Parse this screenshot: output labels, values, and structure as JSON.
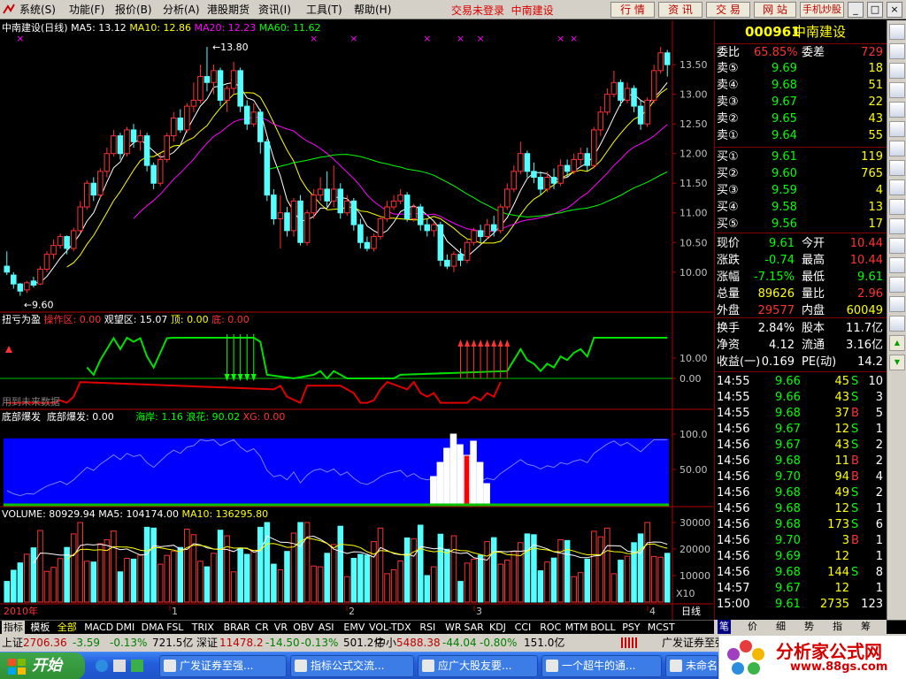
{
  "menubar": {
    "items": [
      "系统(S)",
      "功能(F)",
      "报价(B)",
      "分析(A)",
      "港股期货",
      "资讯(I)",
      "工具(T)",
      "帮助(H)"
    ],
    "login_warning": "交易未登录",
    "stock_name": "中南建设",
    "buttons": [
      "行 情",
      "资 讯",
      "交 易",
      "网 站",
      "手机炒股"
    ],
    "window_buttons": [
      "_",
      "□",
      "×"
    ]
  },
  "main_chart": {
    "title": "中南建设(日线)",
    "ma5": "MA5: 13.12",
    "ma10": "MA10: 12.86",
    "ma20": "MA20: 12.23",
    "ma60": "MA60: 11.62",
    "high_label": "13.80",
    "low_label": "9.60",
    "y_ticks": [
      "13.50",
      "13.00",
      "12.50",
      "12.00",
      "11.50",
      "11.00",
      "10.50",
      "10.00"
    ],
    "candles": [
      [
        10.1,
        10.0,
        10.35,
        9.95
      ],
      [
        9.95,
        9.8,
        10.0,
        9.72
      ],
      [
        9.8,
        9.68,
        9.82,
        9.6
      ],
      [
        9.7,
        9.82,
        9.85,
        9.65
      ],
      [
        9.85,
        9.78,
        9.92,
        9.74
      ],
      [
        9.8,
        10.05,
        10.1,
        9.78
      ],
      [
        10.05,
        10.3,
        10.35,
        10.0
      ],
      [
        10.3,
        10.45,
        10.55,
        10.22
      ],
      [
        10.45,
        10.6,
        10.65,
        10.4
      ],
      [
        10.6,
        10.4,
        10.62,
        10.3
      ],
      [
        10.4,
        10.7,
        10.75,
        10.35
      ],
      [
        10.7,
        11.1,
        11.2,
        10.65
      ],
      [
        11.1,
        11.5,
        11.55,
        11.05
      ],
      [
        11.5,
        11.3,
        11.6,
        11.2
      ],
      [
        11.3,
        11.7,
        11.75,
        11.25
      ],
      [
        11.7,
        12.0,
        12.1,
        11.6
      ],
      [
        12.0,
        12.3,
        12.4,
        11.95
      ],
      [
        12.3,
        12.0,
        12.35,
        11.9
      ],
      [
        12.0,
        12.4,
        12.45,
        11.95
      ],
      [
        12.4,
        12.2,
        12.5,
        12.1
      ],
      [
        12.2,
        12.3,
        12.4,
        12.05
      ],
      [
        12.3,
        11.8,
        12.35,
        11.7
      ],
      [
        11.8,
        11.5,
        11.85,
        11.4
      ],
      [
        11.5,
        11.9,
        12.0,
        11.45
      ],
      [
        11.9,
        12.3,
        12.35,
        11.85
      ],
      [
        12.3,
        12.6,
        12.7,
        12.2
      ],
      [
        12.6,
        12.4,
        12.75,
        12.35
      ],
      [
        12.4,
        12.8,
        12.85,
        12.35
      ],
      [
        12.8,
        12.9,
        13.2,
        12.7
      ],
      [
        12.9,
        13.3,
        13.5,
        12.85
      ],
      [
        13.3,
        13.2,
        13.8,
        13.05
      ],
      [
        13.2,
        13.4,
        13.5,
        13.0
      ],
      [
        13.4,
        12.9,
        13.45,
        12.8
      ],
      [
        12.9,
        13.1,
        13.15,
        12.7
      ],
      [
        13.1,
        13.4,
        13.55,
        13.0
      ],
      [
        13.4,
        12.8,
        13.45,
        12.7
      ],
      [
        12.8,
        12.5,
        12.9,
        12.4
      ],
      [
        12.5,
        12.7,
        12.85,
        12.45
      ],
      [
        12.7,
        12.2,
        12.75,
        12.0
      ],
      [
        12.2,
        11.3,
        12.25,
        11.2
      ],
      [
        11.3,
        10.9,
        11.4,
        10.8
      ],
      [
        10.9,
        11.0,
        11.3,
        10.4
      ],
      [
        11.0,
        10.7,
        11.1,
        10.6
      ],
      [
        10.7,
        11.2,
        11.25,
        10.6
      ],
      [
        11.2,
        10.5,
        11.3,
        10.45
      ],
      [
        10.5,
        11.0,
        11.05,
        10.45
      ],
      [
        11.0,
        11.3,
        11.4,
        10.9
      ],
      [
        11.3,
        11.4,
        11.6,
        11.2
      ],
      [
        11.4,
        11.2,
        11.7,
        11.1
      ],
      [
        11.2,
        11.4,
        11.8,
        11.1
      ],
      [
        11.4,
        11.0,
        11.5,
        10.9
      ],
      [
        11.0,
        11.2,
        11.3,
        10.95
      ],
      [
        11.2,
        10.8,
        11.25,
        10.7
      ],
      [
        10.8,
        10.5,
        10.9,
        10.4
      ],
      [
        10.5,
        10.4,
        10.6,
        10.35
      ],
      [
        10.4,
        10.6,
        10.65,
        10.35
      ],
      [
        10.6,
        10.9,
        10.95,
        10.55
      ],
      [
        10.9,
        11.1,
        11.2,
        10.85
      ],
      [
        11.1,
        11.2,
        11.3,
        11.05
      ],
      [
        11.2,
        11.3,
        11.4,
        11.15
      ],
      [
        11.3,
        10.9,
        11.35,
        10.85
      ],
      [
        10.9,
        11.1,
        11.15,
        10.85
      ],
      [
        11.1,
        10.8,
        11.15,
        10.7
      ],
      [
        10.8,
        10.7,
        10.9,
        10.6
      ],
      [
        10.7,
        10.8,
        10.85,
        10.6
      ],
      [
        10.8,
        10.2,
        10.85,
        10.1
      ],
      [
        10.2,
        10.1,
        10.3,
        10.05
      ],
      [
        10.1,
        10.3,
        10.35,
        10.0
      ],
      [
        10.3,
        10.2,
        10.4,
        10.1
      ],
      [
        10.2,
        10.5,
        10.55,
        10.15
      ],
      [
        10.5,
        10.7,
        10.75,
        10.45
      ],
      [
        10.7,
        10.6,
        10.8,
        10.5
      ],
      [
        10.6,
        10.8,
        10.9,
        10.55
      ],
      [
        10.8,
        10.7,
        10.95,
        10.6
      ],
      [
        10.7,
        11.1,
        11.15,
        10.65
      ],
      [
        11.1,
        11.4,
        11.5,
        11.05
      ],
      [
        11.4,
        11.7,
        11.8,
        11.35
      ],
      [
        11.7,
        12.0,
        12.2,
        11.65
      ],
      [
        12.0,
        11.7,
        12.05,
        11.6
      ],
      [
        11.7,
        11.6,
        11.85,
        11.5
      ],
      [
        11.6,
        11.4,
        11.7,
        11.3
      ],
      [
        11.4,
        11.6,
        11.7,
        11.35
      ],
      [
        11.6,
        11.5,
        11.75,
        11.4
      ],
      [
        11.5,
        11.8,
        11.9,
        11.45
      ],
      [
        11.8,
        11.7,
        11.9,
        11.6
      ],
      [
        11.7,
        11.9,
        12.0,
        11.65
      ],
      [
        11.9,
        12.0,
        12.1,
        11.8
      ],
      [
        12.0,
        11.8,
        12.1,
        11.7
      ],
      [
        11.8,
        12.4,
        12.45,
        11.75
      ],
      [
        12.4,
        12.7,
        12.8,
        12.3
      ],
      [
        12.7,
        13.0,
        13.1,
        12.65
      ],
      [
        13.0,
        13.2,
        13.4,
        12.95
      ],
      [
        13.2,
        12.9,
        13.25,
        12.8
      ],
      [
        12.9,
        13.1,
        13.2,
        12.85
      ],
      [
        13.1,
        12.8,
        13.15,
        12.7
      ],
      [
        12.8,
        12.5,
        12.9,
        12.4
      ],
      [
        12.5,
        12.9,
        12.95,
        12.45
      ],
      [
        12.9,
        13.4,
        13.5,
        12.85
      ],
      [
        13.4,
        13.7,
        13.8,
        13.35
      ],
      [
        13.7,
        13.5,
        13.75,
        13.3
      ]
    ]
  },
  "indicator1": {
    "name": "扭亏为盈",
    "label1": "操作区: 0.00",
    "label2": "观望区: 15.07",
    "label3": "顶: 0.00",
    "label4": "底: 0.00",
    "y_ticks": [
      "10.00",
      "0.00"
    ],
    "footer": "用到未来数据"
  },
  "indicator2": {
    "name": "底部爆发",
    "label1": "底部爆发: 0.00",
    "label2": "海岸: 1.16",
    "label3": "浪花: 90.02",
    "label4": "XG: 0.00",
    "y_ticks": [
      "100.0",
      "50.00"
    ]
  },
  "volume": {
    "label": "VOLUME: 80929.94",
    "ma5": "MA5: 104174.00",
    "ma10": "MA10: 136295.80",
    "y_ticks": [
      "30000",
      "20000",
      "10000"
    ],
    "unit": "X10"
  },
  "xaxis": {
    "year": "2010年",
    "months": [
      "1",
      "2",
      "3",
      "4"
    ],
    "period": "日线"
  },
  "quote": {
    "code": "000961",
    "name": "中南建设",
    "ratio_label": "委比",
    "ratio_value": "65.85%",
    "diff_label": "委差",
    "diff_value": "729",
    "asks": [
      {
        "label": "卖⑤",
        "price": "9.69",
        "vol": "18"
      },
      {
        "label": "卖④",
        "price": "9.68",
        "vol": "51"
      },
      {
        "label": "卖③",
        "price": "9.67",
        "vol": "22"
      },
      {
        "label": "卖②",
        "price": "9.65",
        "vol": "43"
      },
      {
        "label": "卖①",
        "price": "9.64",
        "vol": "55"
      }
    ],
    "bids": [
      {
        "label": "买①",
        "price": "9.61",
        "vol": "119"
      },
      {
        "label": "买②",
        "price": "9.60",
        "vol": "765"
      },
      {
        "label": "买③",
        "price": "9.59",
        "vol": "4"
      },
      {
        "label": "买④",
        "price": "9.58",
        "vol": "13"
      },
      {
        "label": "买⑤",
        "price": "9.56",
        "vol": "17"
      }
    ],
    "stats": [
      {
        "l1": "现价",
        "v1": "9.61",
        "l2": "今开",
        "v2": "10.44"
      },
      {
        "l1": "涨跌",
        "v1": "-0.74",
        "l2": "最高",
        "v2": "10.44"
      },
      {
        "l1": "涨幅",
        "v1": "-7.15%",
        "l2": "最低",
        "v2": "9.61"
      },
      {
        "l1": "总量",
        "v1": "89626",
        "l2": "量比",
        "v2": "2.96"
      },
      {
        "l1": "外盘",
        "v1": "29577",
        "l2": "内盘",
        "v2": "60049"
      }
    ],
    "stats2": [
      {
        "l1": "换手",
        "v1": "2.84%",
        "l2": "股本",
        "v2": "11.7亿"
      },
      {
        "l1": "净资",
        "v1": "4.12",
        "l2": "流通",
        "v2": "3.16亿"
      },
      {
        "l1": "收益(一)",
        "v1": "0.169",
        "l2": "PE(动)",
        "v2": "14.2"
      }
    ],
    "ticks": [
      {
        "t": "14:55",
        "p": "9.66",
        "v": "45",
        "d": "S",
        "n": "10"
      },
      {
        "t": "14:55",
        "p": "9.66",
        "v": "43",
        "d": "S",
        "n": "3"
      },
      {
        "t": "14:55",
        "p": "9.68",
        "v": "37",
        "d": "B",
        "n": "5"
      },
      {
        "t": "14:56",
        "p": "9.67",
        "v": "12",
        "d": "S",
        "n": "1"
      },
      {
        "t": "14:56",
        "p": "9.67",
        "v": "43",
        "d": "S",
        "n": "2"
      },
      {
        "t": "14:56",
        "p": "9.68",
        "v": "11",
        "d": "B",
        "n": "2"
      },
      {
        "t": "14:56",
        "p": "9.70",
        "v": "94",
        "d": "B",
        "n": "4"
      },
      {
        "t": "14:56",
        "p": "9.68",
        "v": "49",
        "d": "S",
        "n": "2"
      },
      {
        "t": "14:56",
        "p": "9.68",
        "v": "12",
        "d": "S",
        "n": "1"
      },
      {
        "t": "14:56",
        "p": "9.68",
        "v": "173",
        "d": "S",
        "n": "6"
      },
      {
        "t": "14:56",
        "p": "9.70",
        "v": "3",
        "d": "B",
        "n": "1"
      },
      {
        "t": "14:56",
        "p": "9.69",
        "v": "12",
        "d": "",
        "n": "1"
      },
      {
        "t": "14:56",
        "p": "9.68",
        "v": "144",
        "d": "S",
        "n": "8"
      },
      {
        "t": "14:57",
        "p": "9.67",
        "v": "12",
        "d": "",
        "n": "1"
      },
      {
        "t": "15:00",
        "p": "9.61",
        "v": "2735",
        "d": "",
        "n": "123"
      }
    ],
    "bottom_tabs": [
      "笔",
      "价",
      "细",
      "势",
      "指",
      "筹"
    ]
  },
  "tabs": [
    "指标",
    "模板",
    "全部",
    "MACD",
    "DMI",
    "DMA",
    "FSL",
    "TRIX",
    "BRAR",
    "CR",
    "VR",
    "OBV",
    "ASI",
    "EMV",
    "VOL-TDX",
    "RSI",
    "WR",
    "SAR",
    "KDJ",
    "CCI",
    "ROC",
    "MTM",
    "BOLL",
    "PSY",
    "MCST"
  ],
  "indexbar": {
    "sh_label": "上证",
    "sh_value": "2706.36",
    "sh_change": "-3.59",
    "sh_pct": "-0.13%",
    "sh_amt": "721.5亿",
    "sz_label": "深证",
    "sz_value": "11478.2",
    "sz_change": "-14.50",
    "sz_pct": "-0.13%",
    "sz_amt": "501.2亿",
    "zx_label": "中小",
    "zx_value": "5488.38",
    "zx_change": "-44.04",
    "zx_pct": "-0.80%",
    "zx_amt": "151.0亿",
    "broker": "广发证券至强版"
  },
  "taskbar": {
    "start": "开始",
    "tasks": [
      "广发证券至强...",
      "指标公式交流...",
      "应广大股友要...",
      "一个超牛的通...",
      "未命名 - ..."
    ]
  },
  "brand": {
    "name": "分析家公式网",
    "url": "www.88gs.com"
  },
  "colors": {
    "up": "#ff3232",
    "down": "#54ffff",
    "ma5": "#ffffff",
    "ma10": "#ffff00",
    "ma20": "#ff00ff",
    "ma60": "#00ff00",
    "axis": "#b00000"
  }
}
